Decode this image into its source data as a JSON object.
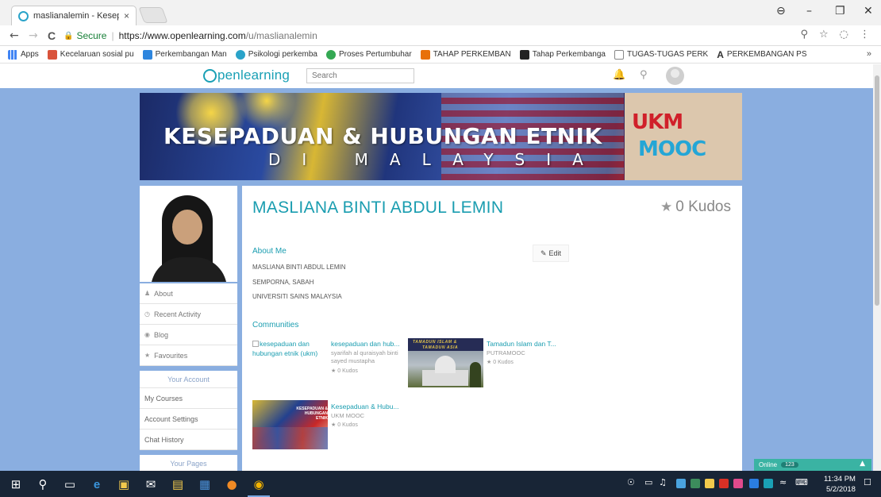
{
  "browser": {
    "tab_title": "maslianalemin - Kesepad",
    "tab_close": "×",
    "nav": {
      "back": "←",
      "forward": "→",
      "reload": "C"
    },
    "secure_label": "Secure",
    "url_host": "https://www.openlearning.com",
    "url_path": "/u/maslianalemin",
    "window_controls": {
      "profile": "⊖",
      "minimize": "–",
      "maximize": "❐",
      "close": "✕"
    },
    "omni_icons": {
      "zoom": "⚲",
      "star": "☆",
      "ext": "◌",
      "menu": "⋮"
    }
  },
  "bookmarks": {
    "items": [
      {
        "label": "Apps",
        "color": "#d93025"
      },
      {
        "label": "Kecelaruan sosial pu",
        "color": "#d9533b"
      },
      {
        "label": "Perkembangan Man",
        "color": "#2e86de"
      },
      {
        "label": "Psikologi perkemba",
        "color": "#2aa3c9"
      },
      {
        "label": "Proses Pertumbuhar",
        "color": "#34a853"
      },
      {
        "label": "TAHAP PERKEMBAN",
        "color": "#e8710a"
      },
      {
        "label": "Tahap Perkembanga",
        "color": "#222222"
      },
      {
        "label": "TUGAS-TUGAS PERK",
        "color": "#ffffff"
      },
      {
        "label": "PERKEMBANGAN PS",
        "color": "#ffffff"
      }
    ],
    "more": "»"
  },
  "site": {
    "logo_text": "penlearning",
    "search_placeholder": "Search",
    "header_icons": {
      "notifications": "🔔",
      "messages": "♲"
    }
  },
  "banner": {
    "title": "KESEPADUAN & HUBUNGAN ETNIK",
    "subtitle": "DI MALAYSIA",
    "logo_top": "UKM",
    "logo_bottom": "MOOC"
  },
  "sidebar": {
    "menu": [
      {
        "icon": "♟",
        "label": "About"
      },
      {
        "icon": "◷",
        "label": "Recent Activity"
      },
      {
        "icon": "◉",
        "label": "Blog"
      },
      {
        "icon": "★",
        "label": "Favourites"
      }
    ],
    "account_heading": "Your Account",
    "account_items": [
      "My Courses",
      "Account Settings",
      "Chat History"
    ],
    "pages_heading": "Your Pages"
  },
  "profile": {
    "name": "MASLIANA BINTI ABDUL LEMIN",
    "kudos": "0 Kudos",
    "about_title": "About Me",
    "edit_label": "Edit",
    "about_lines": [
      "MASLIANA BINTI ABDUL LEMIN",
      "SEMPORNA, SABAH",
      "UNIVERSITI SAINS MALAYSIA"
    ],
    "communities_title": "Communities",
    "courses": [
      {
        "thumb_alt": "kesepaduan dan hubungan etnik (ukm)",
        "title": "kesepaduan dan hub...",
        "author": "syarifah al quraisyah binti sayed mustapha",
        "kudos": "0 Kudos"
      },
      {
        "title": "Tamadun Islam dan T...",
        "author": "PUTRAMOOC",
        "kudos": "0 Kudos",
        "thumb_text_1": "TAMADUN ISLAM &",
        "thumb_text_2": "TAMADUN ASIA"
      },
      {
        "title": "Kesepaduan & Hubu...",
        "author": "UKM MOOC",
        "kudos": "0 Kudos",
        "thumb_text": "KESEPADUAN & HUBUNGAN ETNIK"
      }
    ]
  },
  "chat": {
    "label": "Online",
    "count": "123",
    "caret": "▲"
  },
  "taskbar": {
    "time": "11:34 PM",
    "date": "5/2/2018"
  }
}
